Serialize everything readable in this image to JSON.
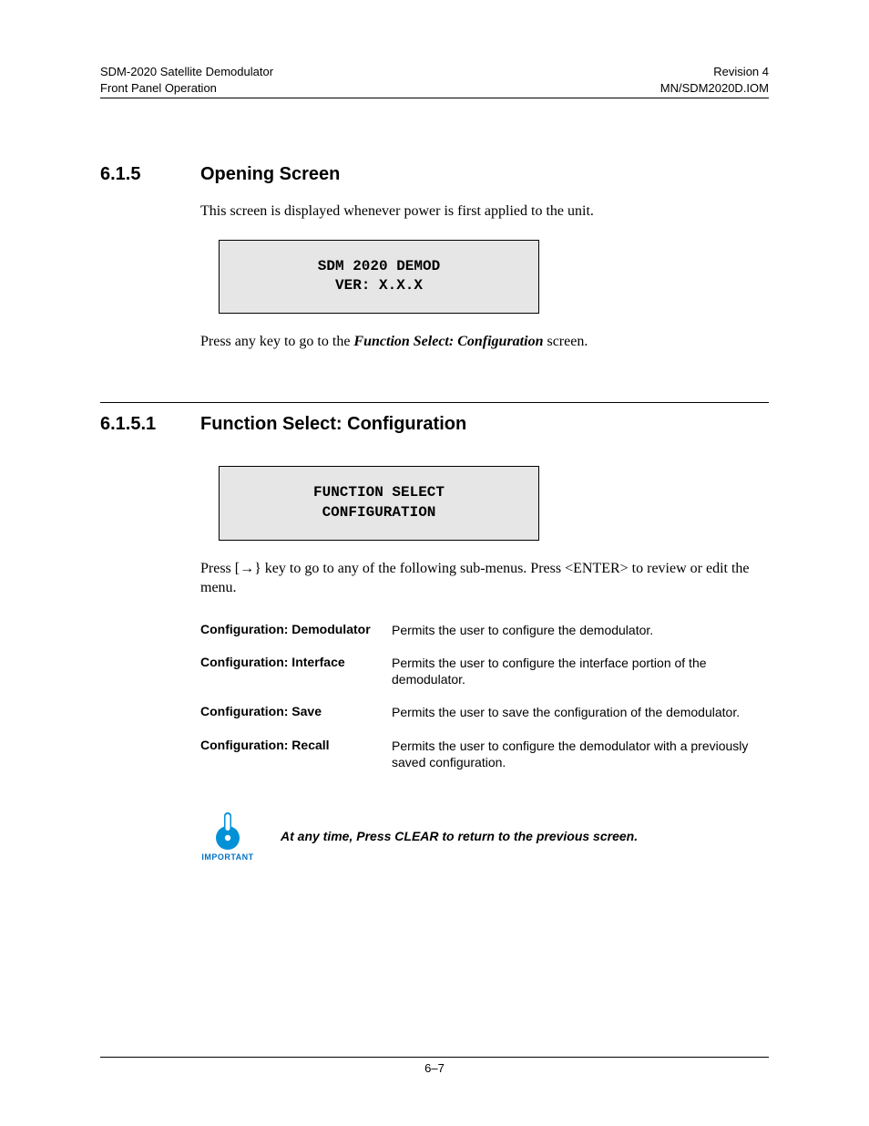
{
  "header": {
    "left_line1": "SDM-2020 Satellite Demodulator",
    "left_line2": "Front Panel Operation",
    "right_line1": "Revision 4",
    "right_line2": "MN/SDM2020D.IOM"
  },
  "section1": {
    "num": "6.1.5",
    "title": "Opening Screen",
    "intro": "This screen is displayed whenever power is first applied to the unit.",
    "lcd_line1": "SDM 2020 DEMOD",
    "lcd_line2": "VER: X.X.X",
    "after_pre": "Press any key to go to the ",
    "after_ital": "Function Select: Configuration",
    "after_post": " screen."
  },
  "section2": {
    "num": "6.1.5.1",
    "title": "Function Select: Configuration",
    "lcd_line1": "FUNCTION SELECT",
    "lcd_line2": "CONFIGURATION",
    "press_pre": "Press [",
    "press_arrow": "→",
    "press_post": "} key to go to any of the following sub-menus. Press <ENTER> to review or edit the menu.",
    "rows": [
      {
        "label": "Configuration: Demodulator",
        "desc": "Permits the user to configure the demodulator."
      },
      {
        "label": "Configuration: Interface",
        "desc": "Permits the user to configure the interface portion of the demodulator."
      },
      {
        "label": "Configuration: Save",
        "desc": "Permits the user to save the configuration of the demodulator."
      },
      {
        "label": "Configuration: Recall",
        "desc": "Permits the user to configure the demodulator with a previously saved configuration."
      }
    ]
  },
  "important": {
    "label": "IMPORTANT",
    "text": "At any time, Press CLEAR to return to the previous screen."
  },
  "footer": {
    "page": "6–7"
  }
}
